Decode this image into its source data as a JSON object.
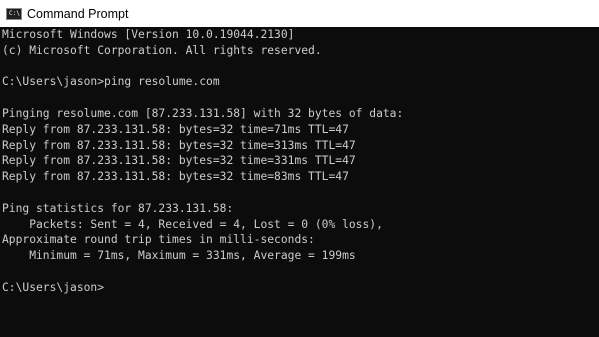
{
  "window": {
    "title": "Command Prompt",
    "icon": "command-prompt-icon",
    "icon_glyph": "C:\\"
  },
  "console": {
    "lines": [
      "Microsoft Windows [Version 10.0.19044.2130]",
      "(c) Microsoft Corporation. All rights reserved.",
      "",
      "C:\\Users\\jason>ping resolume.com",
      "",
      "Pinging resolume.com [87.233.131.58] with 32 bytes of data:",
      "Reply from 87.233.131.58: bytes=32 time=71ms TTL=47",
      "Reply from 87.233.131.58: bytes=32 time=313ms TTL=47",
      "Reply from 87.233.131.58: bytes=32 time=331ms TTL=47",
      "Reply from 87.233.131.58: bytes=32 time=83ms TTL=47",
      "",
      "Ping statistics for 87.233.131.58:",
      "    Packets: Sent = 4, Received = 4, Lost = 0 (0% loss),",
      "Approximate round trip times in milli-seconds:",
      "    Minimum = 71ms, Maximum = 331ms, Average = 199ms",
      "",
      "C:\\Users\\jason>"
    ]
  },
  "colors": {
    "background": "#0c0c0c",
    "foreground": "#cccccc",
    "titlebar": "#ffffff"
  }
}
